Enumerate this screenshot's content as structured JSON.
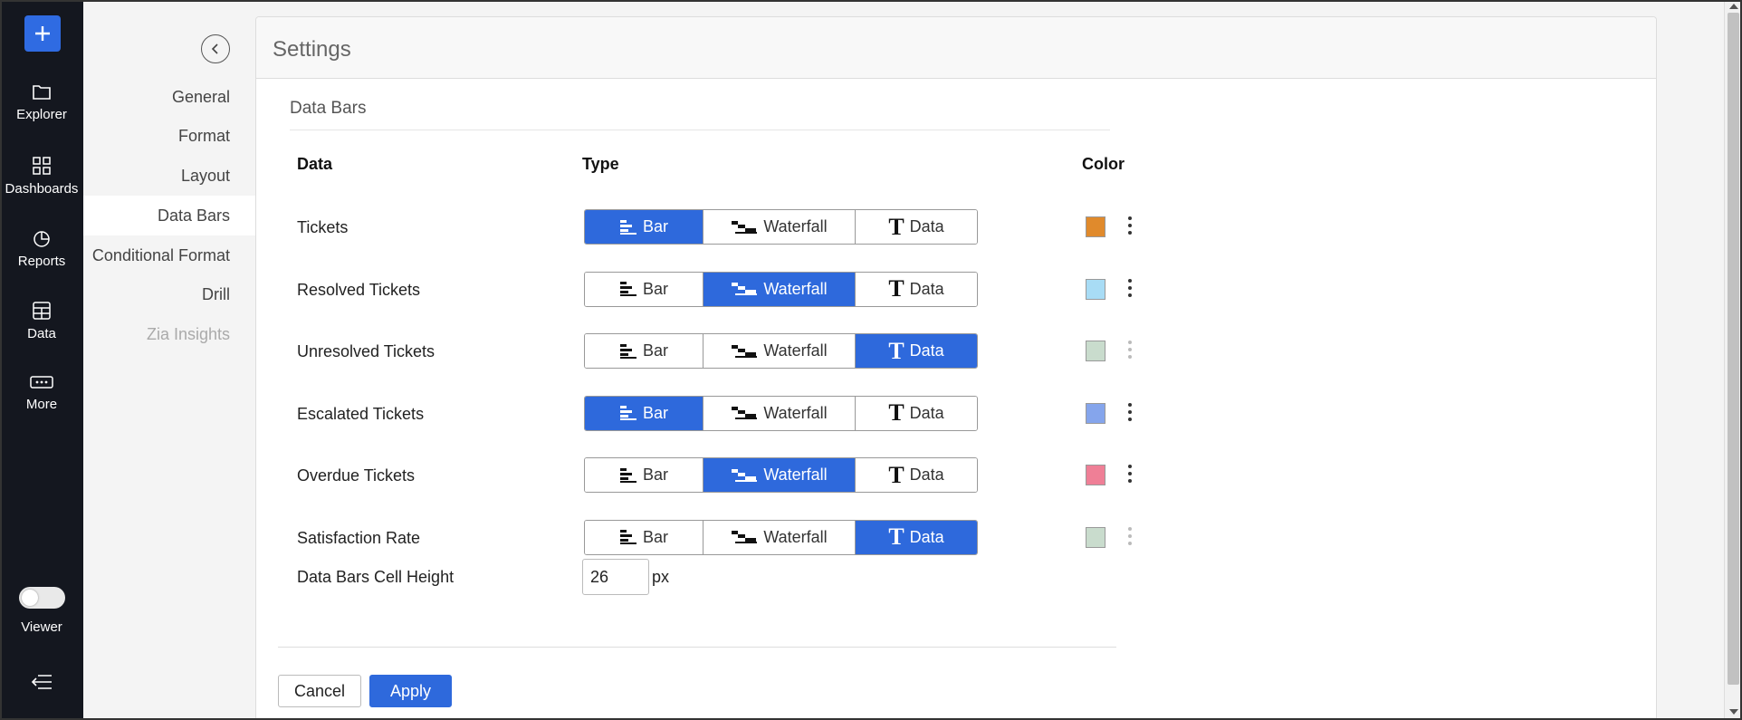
{
  "rail": {
    "items": [
      {
        "label": "Explorer",
        "icon": "folder-icon"
      },
      {
        "label": "Dashboards",
        "icon": "grid-icon"
      },
      {
        "label": "Reports",
        "icon": "pie-chart-icon"
      },
      {
        "label": "Data",
        "icon": "table-icon"
      },
      {
        "label": "More",
        "icon": "more-icon"
      }
    ],
    "viewer_label": "Viewer"
  },
  "subnav": {
    "items": [
      {
        "label": "General"
      },
      {
        "label": "Format"
      },
      {
        "label": "Layout"
      },
      {
        "label": "Data Bars"
      },
      {
        "label": "Conditional Format"
      },
      {
        "label": "Drill"
      },
      {
        "label": "Zia Insights"
      }
    ],
    "active": "Data Bars"
  },
  "panel": {
    "title": "Settings",
    "section_title": "Data Bars",
    "columns": {
      "data": "Data",
      "type": "Type",
      "color": "Color"
    },
    "type_options": {
      "bar": "Bar",
      "waterfall": "Waterfall",
      "data": "Data"
    },
    "rows": [
      {
        "label": "Tickets",
        "selected": "bar",
        "color": "#e08a2c",
        "enabled": true
      },
      {
        "label": "Resolved Tickets",
        "selected": "waterfall",
        "color": "#a8dcf5",
        "enabled": true
      },
      {
        "label": "Unresolved Tickets",
        "selected": "data",
        "color": "#c9dccd",
        "enabled": false
      },
      {
        "label": "Escalated Tickets",
        "selected": "bar",
        "color": "#85a5ec",
        "enabled": true
      },
      {
        "label": "Overdue Tickets",
        "selected": "waterfall",
        "color": "#ef7f96",
        "enabled": true
      },
      {
        "label": "Satisfaction Rate",
        "selected": "data",
        "color": "#c9dccd",
        "enabled": false
      }
    ],
    "cell_height": {
      "label": "Data Bars Cell Height",
      "value": "26",
      "unit": "px"
    },
    "buttons": {
      "cancel": "Cancel",
      "apply": "Apply"
    }
  }
}
